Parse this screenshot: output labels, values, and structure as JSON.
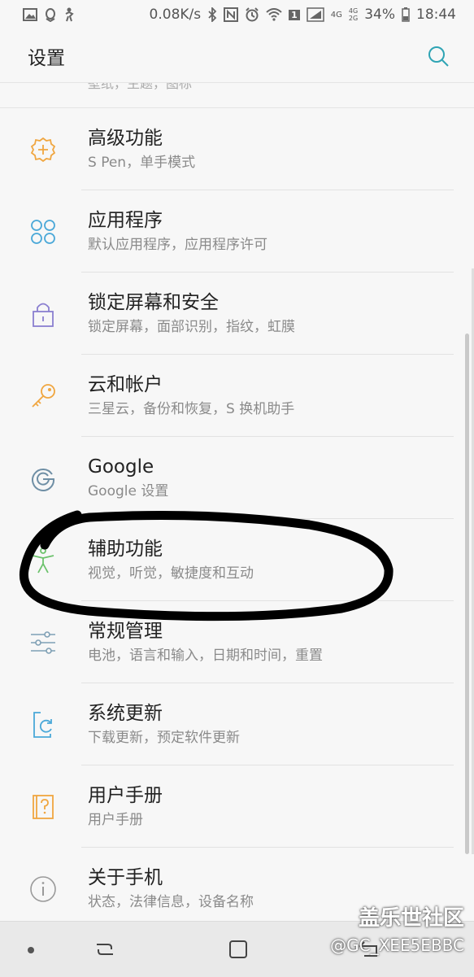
{
  "status_bar": {
    "net_speed": "0.08K/s",
    "battery": "34%",
    "time": "18:44",
    "signal_labels": [
      "4G",
      "4G",
      "2G"
    ],
    "sim_badge": "1",
    "icons": [
      "image-icon",
      "qq-icon",
      "figure-icon",
      "bluetooth-icon",
      "nfc-icon",
      "alarm-icon",
      "wifi-icon",
      "signal-icon",
      "battery-icon"
    ]
  },
  "app_bar": {
    "title": "设置"
  },
  "partial_item_text": "壁纸，主题，图标",
  "items": [
    {
      "title": "高级功能",
      "subtitle": "S Pen，单手模式",
      "icon": "advanced-features-icon",
      "color": "#f0a640"
    },
    {
      "title": "应用程序",
      "subtitle": "默认应用程序，应用程序许可",
      "icon": "apps-icon",
      "color": "#4aa8d8"
    },
    {
      "title": "锁定屏幕和安全",
      "subtitle": "锁定屏幕，面部识别，指纹，虹膜",
      "icon": "lock-icon",
      "color": "#8a7fd0"
    },
    {
      "title": "云和帐户",
      "subtitle": "三星云，备份和恢复，S 换机助手",
      "icon": "key-icon",
      "color": "#f0a640"
    },
    {
      "title": "Google",
      "subtitle": "Google 设置",
      "icon": "google-icon",
      "color": "#6f8fa5"
    },
    {
      "title": "辅助功能",
      "subtitle": "视觉，听觉，敏捷度和互动",
      "icon": "accessibility-icon",
      "color": "#6cc26c"
    },
    {
      "title": "常规管理",
      "subtitle": "电池，语言和输入，日期和时间，重置",
      "icon": "sliders-icon",
      "color": "#7fa0b5"
    },
    {
      "title": "系统更新",
      "subtitle": "下载更新，预定软件更新",
      "icon": "system-update-icon",
      "color": "#4aa8d8"
    },
    {
      "title": "用户手册",
      "subtitle": "用户手册",
      "icon": "manual-icon",
      "color": "#f0a640"
    },
    {
      "title": "关于手机",
      "subtitle": "状态，法律信息，设备名称",
      "icon": "info-icon",
      "color": "#9a9a9a"
    }
  ],
  "watermark": {
    "line1": "盖乐世社区",
    "line2": "@GC_XEE5EBBC"
  },
  "colors": {
    "accent": "#2fa4b4",
    "background": "#f7f7f7",
    "nav_bar": "#e9e9e9"
  }
}
